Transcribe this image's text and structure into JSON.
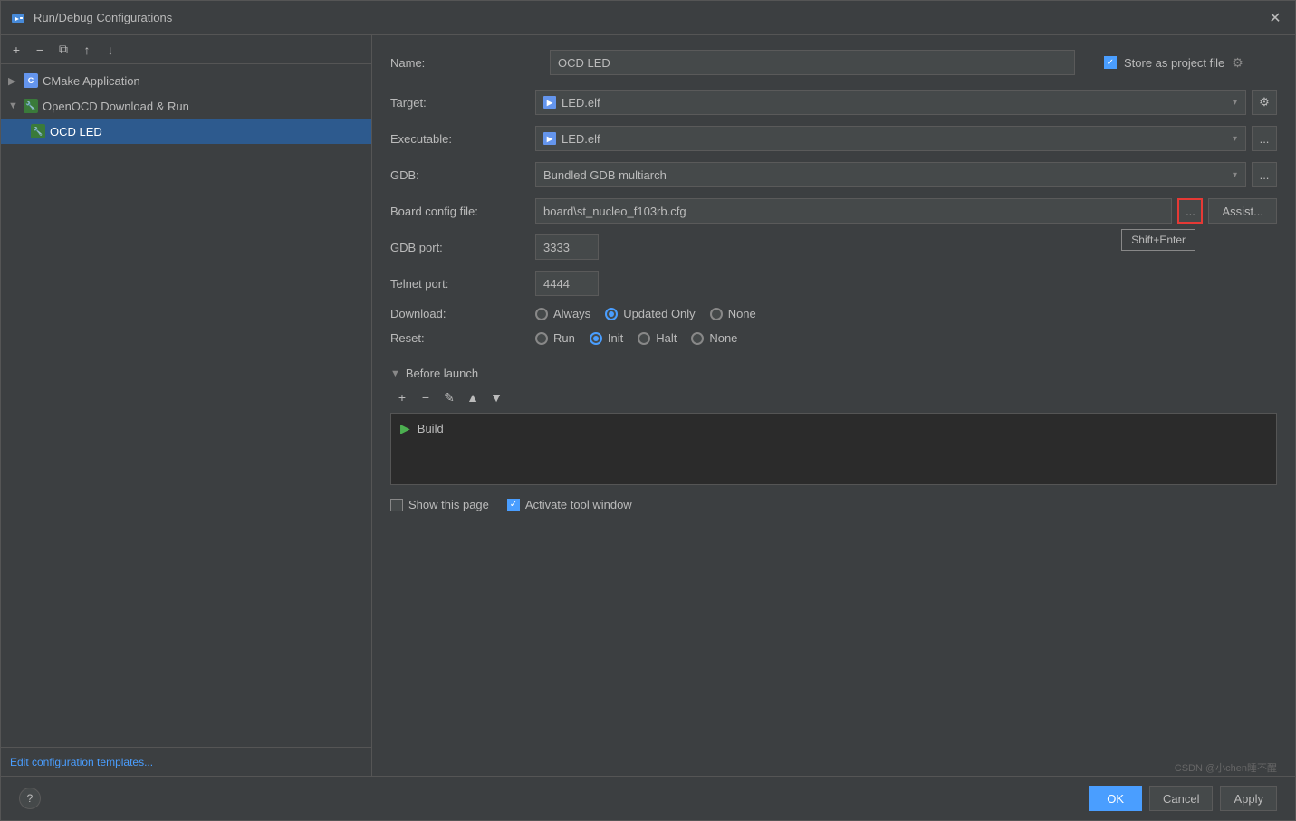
{
  "dialog": {
    "title": "Run/Debug Configurations",
    "close_label": "✕"
  },
  "toolbar": {
    "add_label": "+",
    "remove_label": "−",
    "copy_label": "⧉",
    "move_up_label": "↑",
    "move_down_label": "↓"
  },
  "tree": {
    "cmake_item": {
      "label": "CMake Application",
      "collapsed": true
    },
    "openocd_item": {
      "label": "OpenOCD Download & Run",
      "collapsed": false
    },
    "ocd_led_item": {
      "label": "OCD LED",
      "selected": true
    }
  },
  "footer_left": {
    "edit_templates_label": "Edit configuration templates..."
  },
  "form": {
    "name_label": "Name:",
    "name_value": "OCD LED",
    "store_label": "Store as project file",
    "target_label": "Target:",
    "target_value": "LED.elf",
    "executable_label": "Executable:",
    "executable_value": "LED.elf",
    "gdb_label": "GDB:",
    "gdb_value": "Bundled GDB multiarch",
    "board_config_label": "Board config file:",
    "board_config_value": "board\\st_nucleo_f103rb.cfg",
    "ellipsis_label": "...",
    "assist_label": "Assist...",
    "shift_tooltip": "Shift+Enter",
    "gdb_port_label": "GDB port:",
    "gdb_port_value": "3333",
    "telnet_port_label": "Telnet port:",
    "telnet_port_value": "4444",
    "download_label": "Download:",
    "download_options": [
      "Always",
      "Updated Only",
      "None"
    ],
    "download_selected": "Updated Only",
    "reset_label": "Reset:",
    "reset_options": [
      "Run",
      "Init",
      "Halt",
      "None"
    ],
    "reset_selected": "Init"
  },
  "before_launch": {
    "section_label": "Before launch",
    "add_label": "+",
    "remove_label": "−",
    "edit_label": "✎",
    "up_label": "▲",
    "down_label": "▼",
    "build_item_label": "Build"
  },
  "bottom": {
    "show_page_label": "Show this page",
    "activate_tool_window_label": "Activate tool window",
    "ok_label": "OK",
    "cancel_label": "Cancel",
    "apply_label": "Apply",
    "help_label": "?"
  },
  "watermark": {
    "text": "CSDN @小chen睡不醒"
  }
}
